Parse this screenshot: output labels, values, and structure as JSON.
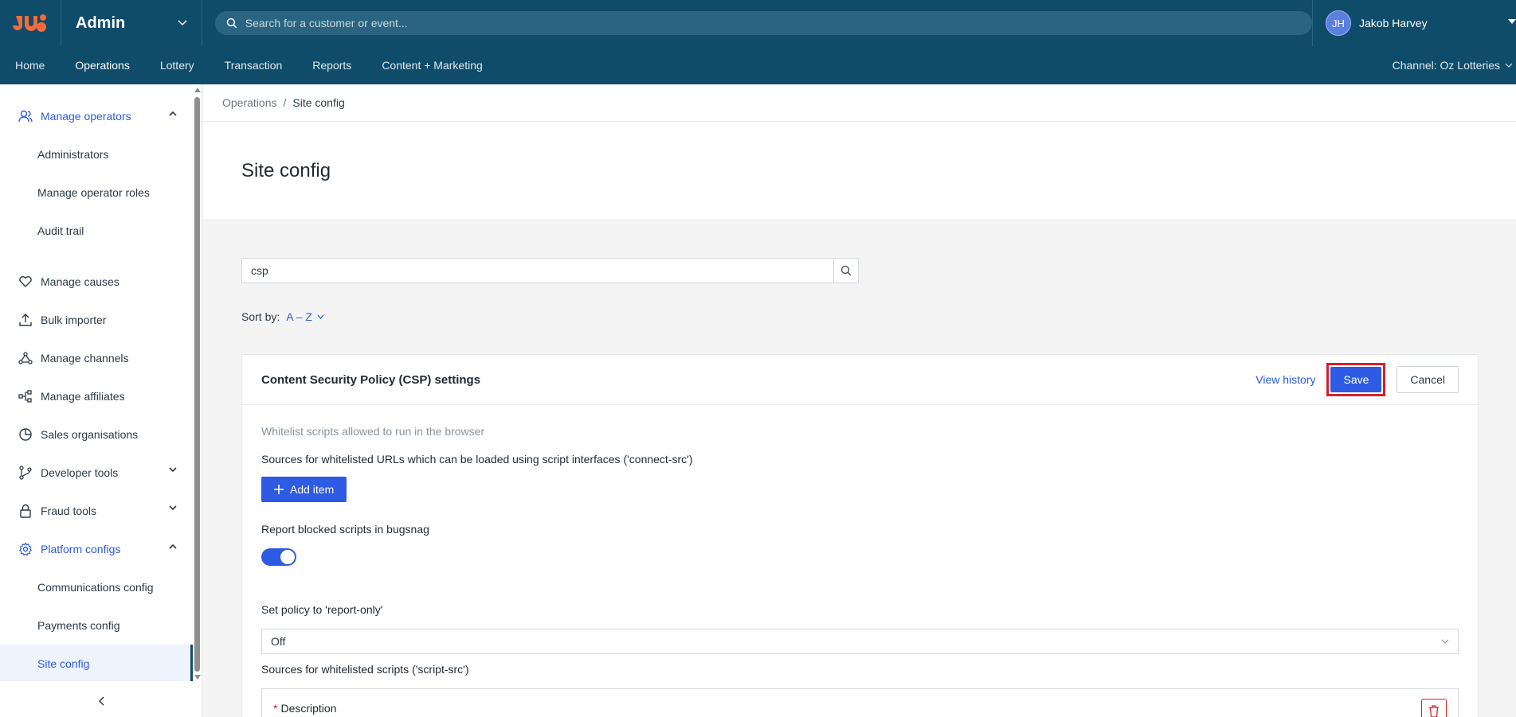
{
  "header": {
    "app_title": "Admin",
    "search_placeholder": "Search for a customer or event...",
    "user_initials": "JH",
    "user_name": "Jakob Harvey"
  },
  "mainnav": {
    "items": [
      "Home",
      "Operations",
      "Lottery",
      "Transaction",
      "Reports",
      "Content + Marketing"
    ],
    "active": "Operations",
    "channel": "Channel: Oz Lotteries"
  },
  "sidebar": {
    "items": [
      {
        "label": "Manage operators",
        "icon": "user-group-icon",
        "expanded": true
      },
      {
        "label": "Administrators"
      },
      {
        "label": "Manage operator roles"
      },
      {
        "label": "Audit trail"
      },
      {
        "label": "Manage causes",
        "icon": "heart-icon"
      },
      {
        "label": "Bulk importer",
        "icon": "upload-icon"
      },
      {
        "label": "Manage channels",
        "icon": "network-icon"
      },
      {
        "label": "Manage affiliates",
        "icon": "affiliate-icon"
      },
      {
        "label": "Sales organisations",
        "icon": "pie-chart-icon"
      },
      {
        "label": "Developer tools",
        "icon": "branch-icon",
        "expanded": false
      },
      {
        "label": "Fraud tools",
        "icon": "lock-icon",
        "expanded": false
      },
      {
        "label": "Platform configs",
        "icon": "gear-icon",
        "expanded": true
      },
      {
        "label": "Communications config"
      },
      {
        "label": "Payments config"
      },
      {
        "label": "Site config",
        "active": true
      }
    ]
  },
  "breadcrumb": {
    "parent": "Operations",
    "separator": "/",
    "current": "Site config"
  },
  "page": {
    "title": "Site config"
  },
  "filter": {
    "value": "csp"
  },
  "sort": {
    "label": "Sort by:",
    "value": "A – Z"
  },
  "card": {
    "title": "Content Security Policy (CSP) settings",
    "view_history": "View history",
    "save": "Save",
    "cancel": "Cancel",
    "hint": "Whitelist scripts allowed to run in the browser",
    "connect_src_label": "Sources for whitelisted URLs which can be loaded using script interfaces ('connect-src')",
    "add_item": "Add item",
    "bugsnag_label": "Report blocked scripts in bugsnag",
    "bugsnag_on": true,
    "report_only_label": "Set policy to 'report-only'",
    "report_only_value": "Off",
    "script_src_label": "Sources for whitelisted scripts ('script-src')",
    "description_label": "Description"
  },
  "colors": {
    "brand": "#0f4c6a",
    "accent": "#2d5be3",
    "danger": "#d6202a"
  }
}
